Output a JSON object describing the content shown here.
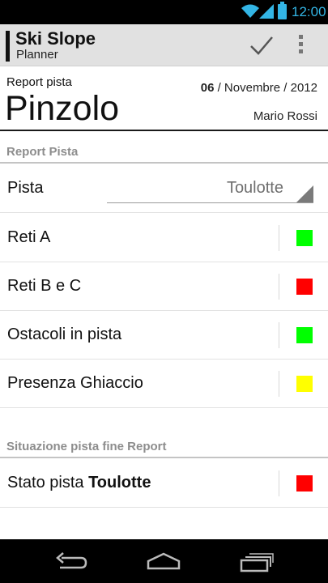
{
  "status_bar": {
    "time": "12:00"
  },
  "action_bar": {
    "title": "Ski Slope",
    "subtitle": "Planner",
    "confirm_icon": "checkmark-icon",
    "overflow_icon": "overflow-menu-icon"
  },
  "header": {
    "report_label": "Report pista",
    "slope_name": "Pinzolo",
    "date_day": "06",
    "date_rest": " / Novembre / 2012",
    "author": "Mario Rossi"
  },
  "section_report": {
    "title": "Report Pista",
    "slope_row": {
      "label": "Pista",
      "selected": "Toulotte"
    },
    "rows": [
      {
        "label": "Reti A",
        "status_color": "#00ff00"
      },
      {
        "label": "Reti B e C",
        "status_color": "#ff0000"
      },
      {
        "label": "Ostacoli in pista",
        "status_color": "#00ff00"
      },
      {
        "label": "Presenza Ghiaccio",
        "status_color": "#ffff00"
      }
    ]
  },
  "section_end": {
    "title": "Situazione pista fine Report",
    "state_label": "Stato pista ",
    "state_slope": "Toulotte",
    "status_color": "#ff0000"
  },
  "colors": {
    "accent": "#33b5e5",
    "green": "#00ff00",
    "red": "#ff0000",
    "yellow": "#ffff00"
  },
  "nav_bar": {
    "back_icon": "back-icon",
    "home_icon": "home-icon",
    "recents_icon": "recents-icon"
  }
}
